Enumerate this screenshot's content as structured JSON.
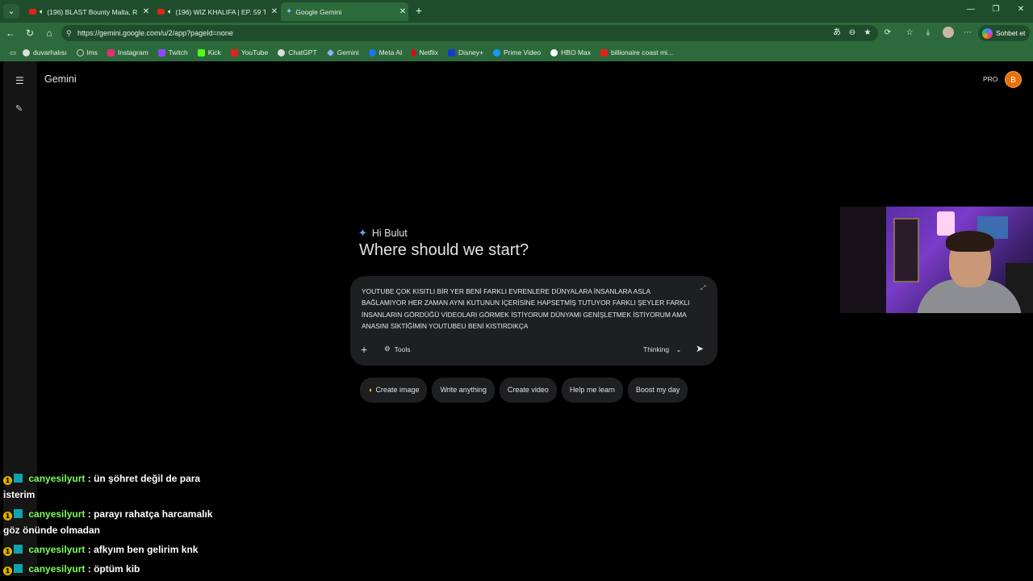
{
  "browser": {
    "tabs": [
      {
        "title": "(196) BLAST Bounty Malta, Ro",
        "icon": "youtube-icon",
        "audio": true
      },
      {
        "title": "(196) WIZ KHALIFA | EP. 59 TH",
        "icon": "youtube-icon",
        "audio": true
      },
      {
        "title": "Google Gemini",
        "icon": "gemini-icon",
        "active": true
      }
    ],
    "url": "https://gemini.google.com/u/2/app?pageId=none",
    "copilot_label": "Sohbet et",
    "bookmarks": [
      {
        "label": "duvarhalısı",
        "color": "#dddddd"
      },
      {
        "label": "lms",
        "color": "#cccccc"
      },
      {
        "label": "Instagram",
        "color": "#e1306c"
      },
      {
        "label": "Twitch",
        "color": "#9146ff"
      },
      {
        "label": "Kick",
        "color": "#53fc18"
      },
      {
        "label": "YouTube",
        "color": "#e62117"
      },
      {
        "label": "ChatGPT",
        "color": "#dddddd"
      },
      {
        "label": "Gemini",
        "color": "#8ab4f8"
      },
      {
        "label": "Meta AI",
        "color": "#1877f2"
      },
      {
        "label": "Netflix",
        "color": "#e50914"
      },
      {
        "label": "Disney+",
        "color": "#113ccf"
      },
      {
        "label": "Prime Video",
        "color": "#1399ff"
      },
      {
        "label": "HBO Max",
        "color": "#ffffff"
      },
      {
        "label": "billionaire coast mi...",
        "color": "#e62117"
      }
    ]
  },
  "app": {
    "brand": "Gemini",
    "plan": "PRO",
    "avatar_letter": "B"
  },
  "main": {
    "greeting": "Hi Bulut",
    "headline": "Where should we start?",
    "prompt_text": "YOUTUBE ÇOK KISITLI BİR YER BENİ FARKLI EVRENLERE DÜNYALARA İNSANLARA ASLA BAĞLAMIYOR HER ZAMAN AYNI KUTUNUN İÇERİSİNE HAPSETMİŞ TUTUYOR FARKLI ŞEYLER FARKLI İNSANLARIN GÖRDÜĞÜ VİDEOLARI GÖRMEK İSTİYORUM DÜNYAMI GENİŞLETMEK İSTİYORUM AMA ANASINI SİKTİĞİMİN YOUTUBEU BENİ KISTIRDIKÇA",
    "tools_label": "Tools",
    "mode_label": "Thinking",
    "chips": [
      "Create image",
      "Write anything",
      "Create video",
      "Help me learn",
      "Boost my day"
    ]
  },
  "chat": [
    {
      "user": "canyesilyurt",
      "message": "ün şöhret değil de para isterim"
    },
    {
      "user": "canyesilyurt",
      "message": "parayı rahatça harcamalık göz önünde olmadan"
    },
    {
      "user": "canyesilyurt",
      "message": "afkyım ben gelirim knk"
    },
    {
      "user": "canyesilyurt",
      "message": "öptüm kib"
    }
  ]
}
